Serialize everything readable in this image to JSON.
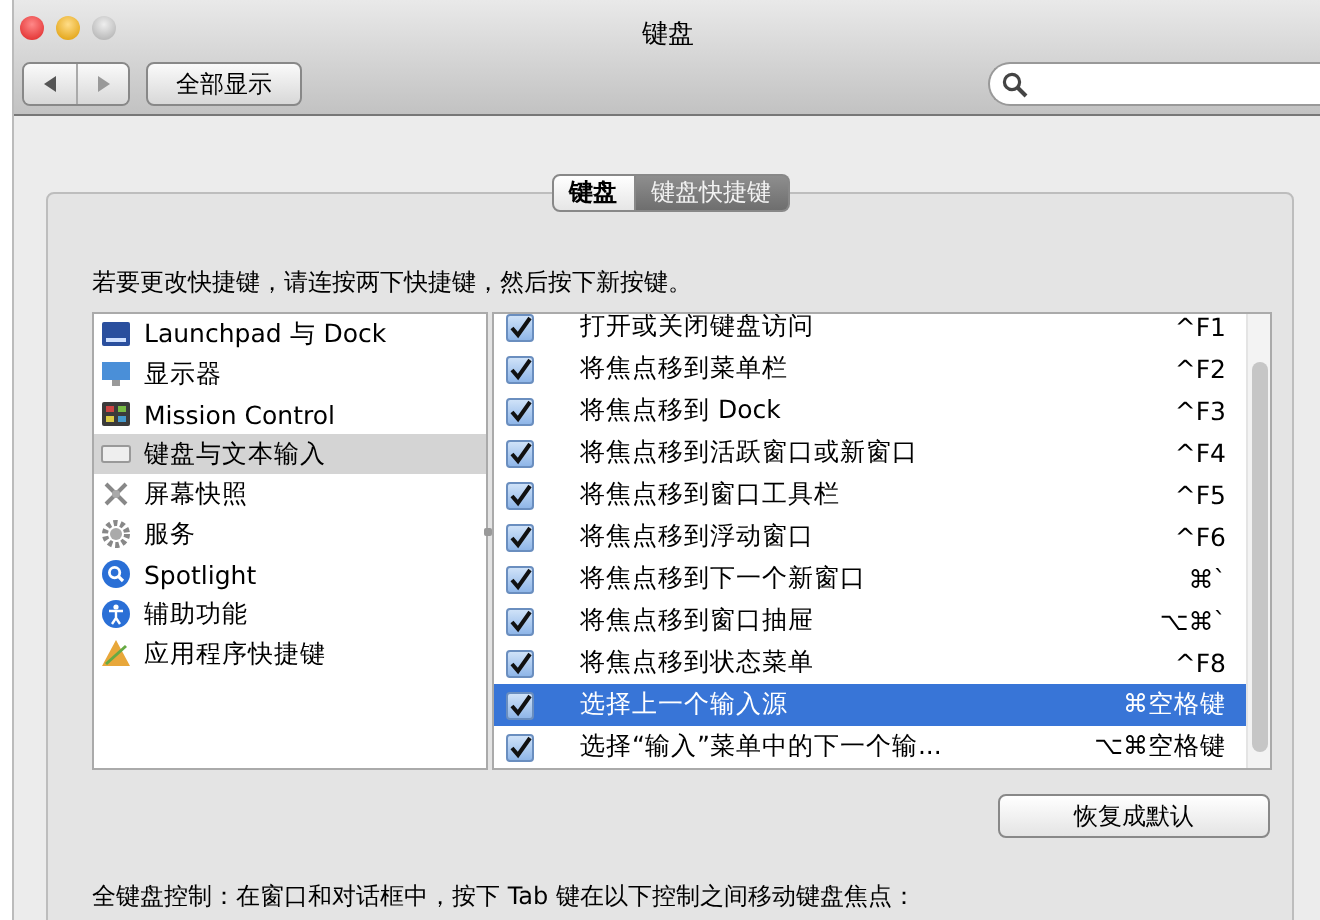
{
  "window": {
    "title": "键盘"
  },
  "toolbar": {
    "show_all": "全部显示"
  },
  "tabs": [
    {
      "label": "键盘",
      "selected": false
    },
    {
      "label": "键盘快捷键",
      "selected": true
    }
  ],
  "instruction": "若要更改快捷键，请连按两下快捷键，然后按下新按键。",
  "categories": [
    {
      "label": "Launchpad 与 Dock",
      "selected": false
    },
    {
      "label": "显示器",
      "selected": false
    },
    {
      "label": "Mission Control",
      "selected": false
    },
    {
      "label": "键盘与文本输入",
      "selected": true
    },
    {
      "label": "屏幕快照",
      "selected": false
    },
    {
      "label": "服务",
      "selected": false
    },
    {
      "label": "Spotlight",
      "selected": false
    },
    {
      "label": "辅助功能",
      "selected": false
    },
    {
      "label": "应用程序快捷键",
      "selected": false
    }
  ],
  "shortcuts": [
    {
      "checked": true,
      "label": "打开或关闭键盘访问",
      "keys": "^F1",
      "selected": false
    },
    {
      "checked": true,
      "label": "将焦点移到菜单栏",
      "keys": "^F2",
      "selected": false
    },
    {
      "checked": true,
      "label": "将焦点移到 Dock",
      "keys": "^F3",
      "selected": false
    },
    {
      "checked": true,
      "label": "将焦点移到活跃窗口或新窗口",
      "keys": "^F4",
      "selected": false
    },
    {
      "checked": true,
      "label": "将焦点移到窗口工具栏",
      "keys": "^F5",
      "selected": false
    },
    {
      "checked": true,
      "label": "将焦点移到浮动窗口",
      "keys": "^F6",
      "selected": false
    },
    {
      "checked": true,
      "label": "将焦点移到下一个新窗口",
      "keys": "⌘`",
      "selected": false
    },
    {
      "checked": true,
      "label": "将焦点移到窗口抽屉",
      "keys": "⌥⌘`",
      "selected": false
    },
    {
      "checked": true,
      "label": "将焦点移到状态菜单",
      "keys": "^F8",
      "selected": false
    },
    {
      "checked": true,
      "label": "选择上一个输入源",
      "keys": "⌘空格键",
      "selected": true
    },
    {
      "checked": true,
      "label": "选择“输入”菜单中的下一个输...",
      "keys": "⌥⌘空格键",
      "selected": false
    }
  ],
  "restore_button": "恢复成默认",
  "footer": "全键盘控制：在窗口和对话框中，按下 Tab 键在以下控制之间移动键盘焦点："
}
